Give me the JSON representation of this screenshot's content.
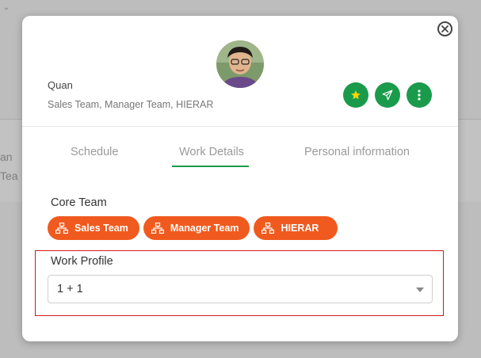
{
  "background": {
    "top_fragment": "„",
    "row_fragment_1": "an",
    "row_fragment_2": "Tea"
  },
  "modal": {
    "close_icon": "close-circle-icon",
    "user": {
      "name": "Quan",
      "teams": "Sales Team, Manager Team, HIERAR"
    },
    "actions": [
      {
        "icon": "star-icon",
        "color": "#1a9b4b"
      },
      {
        "icon": "send-icon",
        "color": "#1a9b4b"
      },
      {
        "icon": "more-vertical-icon",
        "color": "#1a9b4b"
      }
    ],
    "tabs": [
      {
        "label": "Schedule",
        "active": false
      },
      {
        "label": "Work Details",
        "active": true
      },
      {
        "label": "Personal information",
        "active": false
      }
    ],
    "core_team": {
      "label": "Core Team",
      "chips": [
        {
          "label": "Sales Team",
          "icon": "org-chart-icon"
        },
        {
          "label": "Manager Team",
          "icon": "org-chart-icon"
        },
        {
          "label": "HIERAR",
          "icon": "org-chart-icon"
        }
      ]
    },
    "work_profile": {
      "label": "Work Profile",
      "selected": "1 + 1"
    }
  },
  "colors": {
    "accent_green": "#1a9b4b",
    "chip_orange": "#f05a1e",
    "highlight_red": "#d01a1a"
  }
}
